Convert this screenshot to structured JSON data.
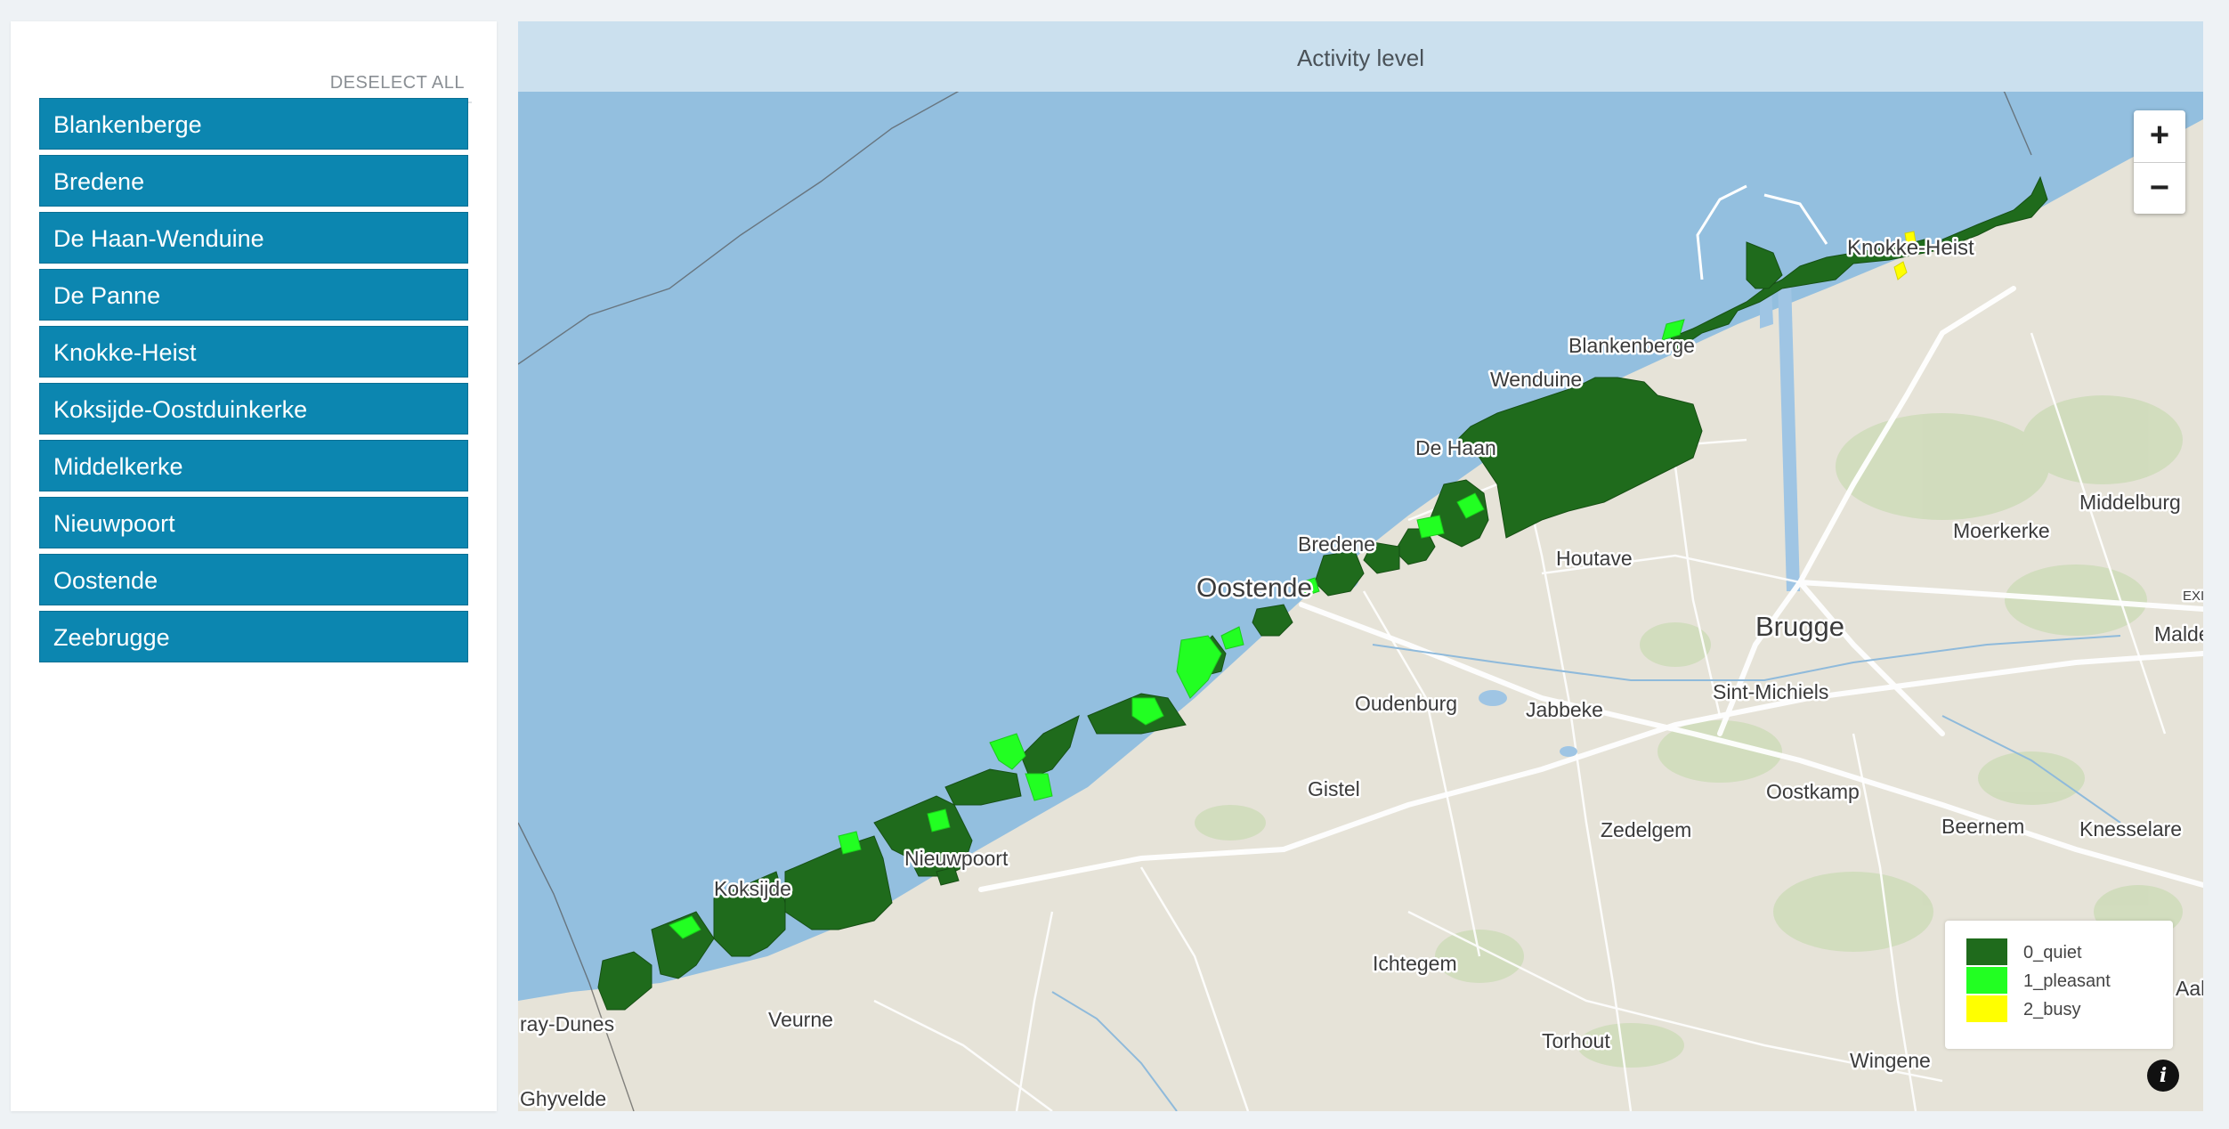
{
  "sidebar": {
    "deselect_label": "DESELECT ALL",
    "items": [
      {
        "label": "Blankenberge"
      },
      {
        "label": "Bredene"
      },
      {
        "label": "De Haan-Wenduine"
      },
      {
        "label": "De Panne"
      },
      {
        "label": "Knokke-Heist"
      },
      {
        "label": "Koksijde-Oostduinkerke"
      },
      {
        "label": "Middelkerke"
      },
      {
        "label": "Nieuwpoort"
      },
      {
        "label": "Oostende"
      },
      {
        "label": "Zeebrugge"
      }
    ]
  },
  "map": {
    "title": "Activity level",
    "zoom_in_label": "+",
    "zoom_out_label": "−",
    "info_label": "i",
    "places": {
      "knokke_heist": "Knokke-Heist",
      "blankenberge": "Blankenberge",
      "wenduine": "Wenduine",
      "de_haan": "De Haan",
      "bredene": "Bredene",
      "oostende": "Oostende",
      "houtave": "Houtave",
      "brugge": "Brugge",
      "sint_michiels": "Sint-Michiels",
      "middelburg": "Middelburg",
      "moerkerke": "Moerkerke",
      "maldegem": "Maldeg",
      "exit": "EXI",
      "oudenburg": "Oudenburg",
      "jabbeke": "Jabbeke",
      "gistel": "Gistel",
      "oostkamp": "Oostkamp",
      "beernem": "Beernem",
      "knesselare": "Knesselare",
      "zedelgem": "Zedelgem",
      "nieuwpoort": "Nieuwpoort",
      "koksijde": "Koksijde",
      "bray_dunes": "ray-Dunes",
      "veurne": "Veurne",
      "ichtegem": "Ichtegem",
      "torhout": "Torhout",
      "wingene": "Wingene",
      "ghyvelde": "Ghyvelde",
      "aalter": "Aalt"
    }
  },
  "legend": {
    "items": [
      {
        "label": "0_quiet",
        "color": "#1f6b1c"
      },
      {
        "label": "1_pleasant",
        "color": "#22ff22"
      },
      {
        "label": "2_busy",
        "color": "#ffff00"
      }
    ]
  },
  "colors": {
    "sidebar_item": "#0c86b0",
    "sea": "#93bfdf",
    "land": "#e6e3d8",
    "header": "#cbe0ee"
  }
}
